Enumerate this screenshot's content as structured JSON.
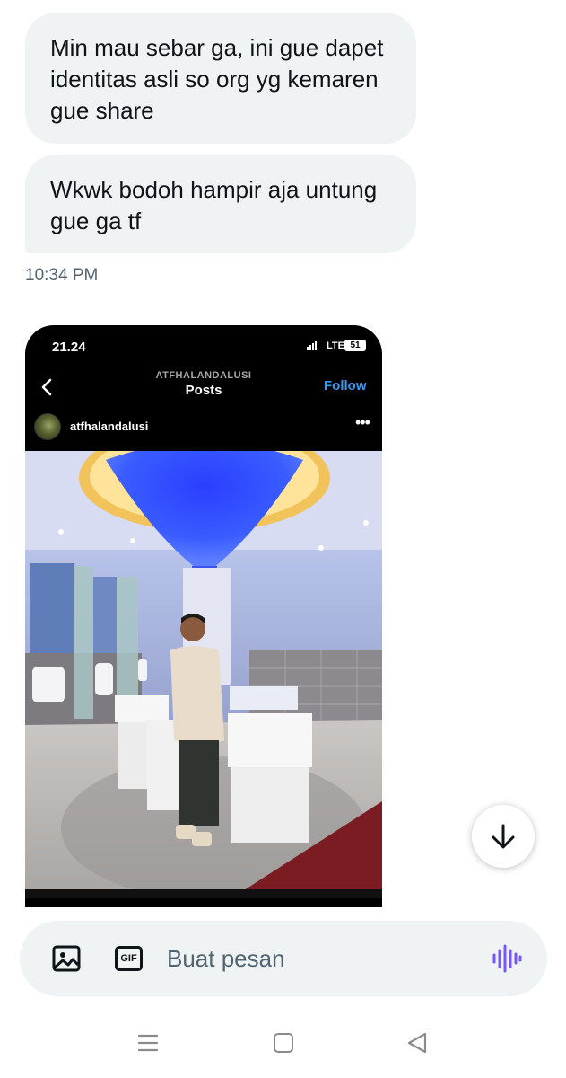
{
  "messages": [
    {
      "text": "Min mau sebar ga, ini gue dapet identitas asli so org yg kemaren gue share"
    },
    {
      "text": "Wkwk bodoh hampir aja untung gue ga tf"
    }
  ],
  "timestamp": "10:34 PM",
  "embedded_screenshot": {
    "status_time": "21.24",
    "network": "LTE",
    "battery": "51",
    "header_handle": "ATFHALANDALUSI",
    "header_title": "Posts",
    "follow_label": "Follow",
    "username": "atfhalandalusi",
    "more_label": "•••"
  },
  "composer": {
    "gif_label": "GIF",
    "placeholder": "Buat pesan"
  },
  "colors": {
    "bubble_bg": "#eff3f4",
    "follow_blue": "#3897f0",
    "voice_purple": "#7856ff",
    "muted_text": "#536471"
  },
  "icons": [
    "image-icon",
    "gif-icon",
    "voice-icon",
    "arrow-down-icon",
    "chevron-left-icon",
    "menu-icon",
    "home-icon",
    "back-icon"
  ]
}
